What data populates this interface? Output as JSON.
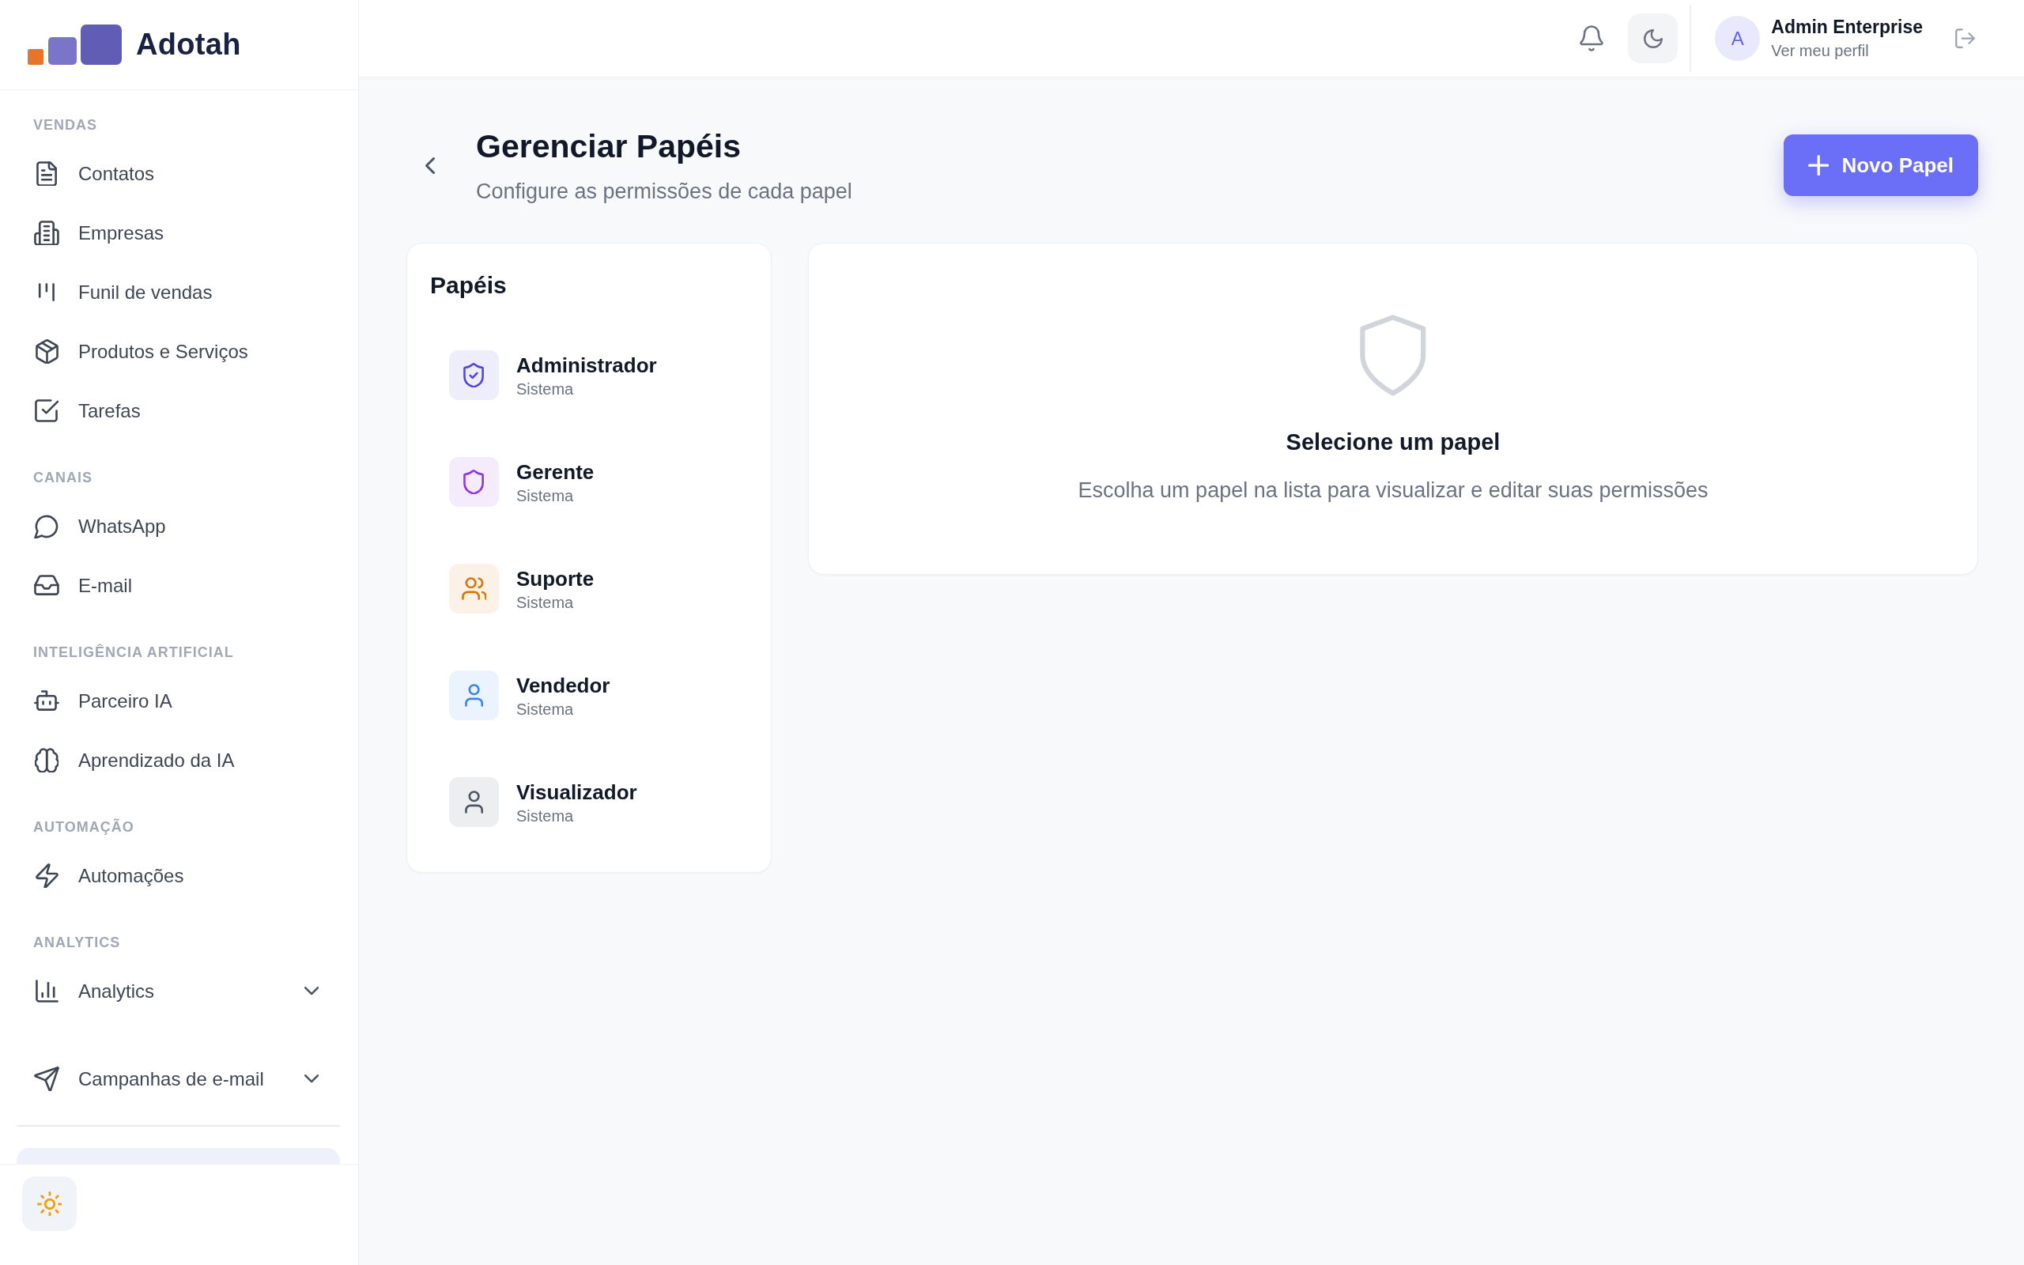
{
  "sidebar": {
    "brand": "Adotah",
    "sections": [
      {
        "title": "VENDAS",
        "items": [
          {
            "label": "Contatos"
          },
          {
            "label": "Empresas"
          },
          {
            "label": "Funil de vendas"
          },
          {
            "label": "Produtos e Serviços"
          },
          {
            "label": "Tarefas"
          }
        ]
      },
      {
        "title": "CANAIS",
        "items": [
          {
            "label": "WhatsApp"
          },
          {
            "label": "E-mail"
          }
        ]
      },
      {
        "title": "INTELIGÊNCIA ARTIFICIAL",
        "items": [
          {
            "label": "Parceiro IA"
          },
          {
            "label": "Aprendizado da IA"
          }
        ]
      },
      {
        "title": "AUTOMAÇÃO",
        "items": [
          {
            "label": "Automações"
          }
        ]
      },
      {
        "title": "ANALYTICS",
        "items": [
          {
            "label": "Analytics",
            "expanded": false
          }
        ]
      },
      {
        "items": [
          {
            "label": "Campanhas de e-mail",
            "expanded": false
          }
        ]
      }
    ]
  },
  "topbar": {
    "user": {
      "initial": "A",
      "name": "Admin Enterprise",
      "profile_link": "Ver meu perfil"
    }
  },
  "page": {
    "title": "Gerenciar Papéis",
    "subtitle": "Configure as permissões de cada papel",
    "new_button": "Novo Papel"
  },
  "roles_panel": {
    "title": "Papéis",
    "roles": [
      {
        "name": "Administrador",
        "scope": "Sistema",
        "color": "#4f46e5",
        "selected": false
      },
      {
        "name": "Gerente",
        "scope": "Sistema",
        "color": "#9333ea",
        "selected": false
      },
      {
        "name": "Suporte",
        "scope": "Sistema",
        "color": "#d97706",
        "selected": false
      },
      {
        "name": "Vendedor",
        "scope": "Sistema",
        "color": "#3b82f6",
        "selected": false
      },
      {
        "name": "Visualizador",
        "scope": "Sistema",
        "color": "#4b5563",
        "selected": false
      }
    ]
  },
  "detail_panel": {
    "title": "Selecione um papel",
    "message": "Escolha um papel na lista para visualizar e editar suas permissões"
  }
}
